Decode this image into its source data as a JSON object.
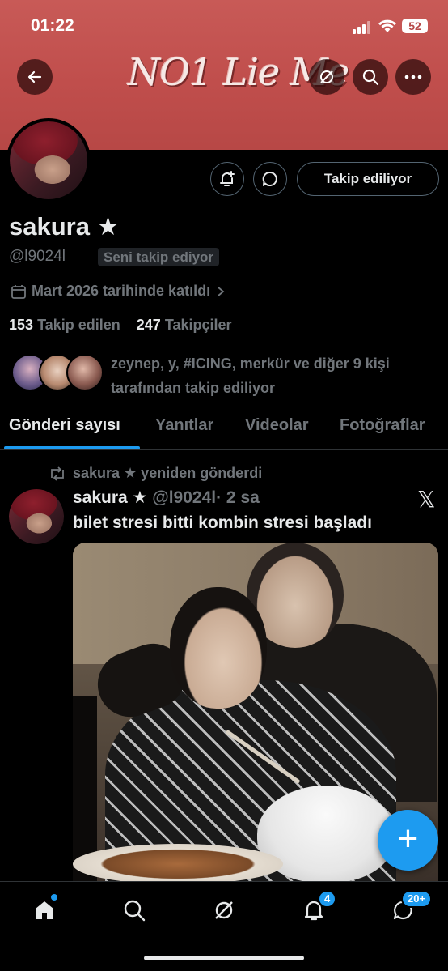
{
  "status_bar": {
    "time": "01:22",
    "battery": "52"
  },
  "banner": {
    "text": "NO1 Lie Me"
  },
  "profile": {
    "name": "sakura ★",
    "handle": "@l9024l",
    "follows_you_badge": "Seni takip ediyor",
    "joined": "Mart 2026 tarihinde katıldı",
    "following_count": "153",
    "following_label": "Takip edilen",
    "followers_count": "247",
    "followers_label": "Takipçiler",
    "followed_by_text": "zeynep, y, #ICING, merkür ve diğer 9 kişi tarafından takip ediliyor",
    "follow_button": "Takip ediliyor"
  },
  "tabs": [
    "Gönderi sayısı",
    "Yanıtlar",
    "Videolar",
    "Fotoğraflar"
  ],
  "post": {
    "repost_label": "sakura ★ yeniden gönderdi",
    "author_name": "sakura ★",
    "author_handle": "@l9024l",
    "time": "· 2 sa",
    "text": "bilet stresi bitti kombin stresi başladı",
    "source_icon": "x-logo-icon"
  },
  "fab": {
    "label": "+"
  },
  "bottom_nav": {
    "items": [
      "home-icon",
      "search-icon",
      "grok-icon",
      "notifications-icon",
      "messages-icon"
    ],
    "notifications_badge": "4",
    "messages_badge": "20+"
  },
  "colors": {
    "accent": "#1d9bf0",
    "banner": "#c04e4c",
    "background": "#000000",
    "muted": "#71767b"
  }
}
